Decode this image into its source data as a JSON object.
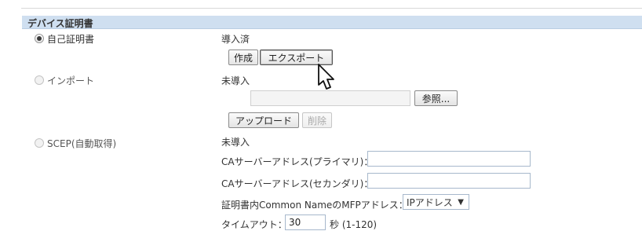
{
  "section": {
    "title": "デバイス証明書"
  },
  "options": {
    "self_cert": {
      "label": "自己証明書",
      "selected": true,
      "status": "導入済",
      "create_label": "作成",
      "export_label": "エクスポート"
    },
    "import": {
      "label": "インポート",
      "selected": false,
      "status": "未導入",
      "file_path": "",
      "browse_label": "参照...",
      "upload_label": "アップロード",
      "delete_label": "削除"
    },
    "scep": {
      "label": "SCEP(自動取得)",
      "selected": false,
      "status": "未導入",
      "ca_primary_label": "CAサーバーアドレス(プライマリ)：",
      "ca_primary_value": "",
      "ca_secondary_label": "CAサーバーアドレス(セカンダリ)：",
      "ca_secondary_value": "",
      "cn_label": "証明書内Common NameのMFPアドレス：",
      "cn_value": "IPアドレス",
      "timeout_label": "タイムアウト：",
      "timeout_value": "30",
      "timeout_unit": "秒 (1-120)"
    }
  },
  "icons": {
    "cursor": "mouse-pointer-icon",
    "caret": "chevron-down-icon"
  }
}
